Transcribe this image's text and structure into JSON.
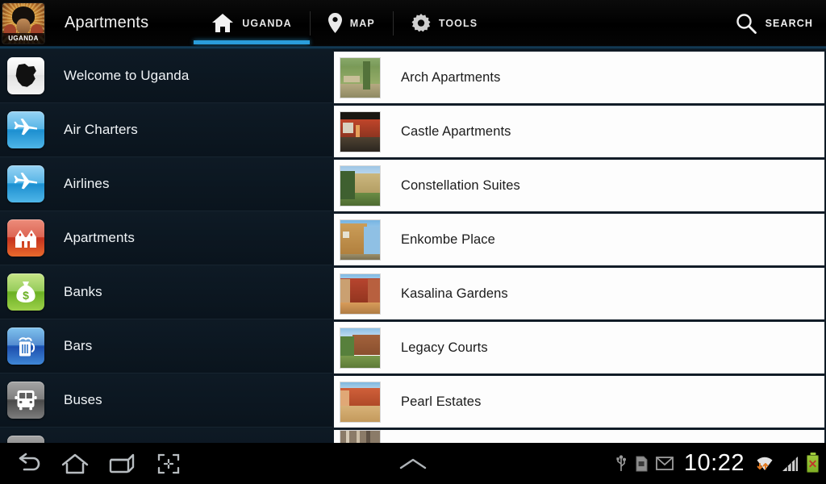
{
  "header": {
    "app_icon_label": "UGANDA",
    "title": "Apartments",
    "tabs": [
      {
        "label": "UGANDA",
        "icon": "home-icon",
        "active": true
      },
      {
        "label": "MAP",
        "icon": "location-pin-icon",
        "active": false
      },
      {
        "label": "TOOLS",
        "icon": "gear-icon",
        "active": false
      }
    ],
    "search": {
      "label": "SEARCH",
      "icon": "search-icon"
    },
    "accent_color": "#2a9ddb"
  },
  "sidebar": {
    "items": [
      {
        "label": "Welcome to Uganda",
        "icon": "uganda-map-icon",
        "icon_style": "ico-white"
      },
      {
        "label": "Air Charters",
        "icon": "airplane-icon",
        "icon_style": "ico-blue"
      },
      {
        "label": "Airlines",
        "icon": "airplane-icon",
        "icon_style": "ico-blue"
      },
      {
        "label": "Apartments",
        "icon": "house-icon",
        "icon_style": "ico-red"
      },
      {
        "label": "Banks",
        "icon": "money-bag-icon",
        "icon_style": "ico-green"
      },
      {
        "label": "Bars",
        "icon": "beer-mug-icon",
        "icon_style": "ico-navy"
      },
      {
        "label": "Buses",
        "icon": "bus-icon",
        "icon_style": "ico-gray"
      },
      {
        "label": "",
        "icon": "partial-icon",
        "icon_style": "ico-gray"
      }
    ]
  },
  "list": {
    "items": [
      {
        "label": "Arch Apartments",
        "thumb": "green-garden-walkway"
      },
      {
        "label": "Castle Apartments",
        "thumb": "red-lit-terrace"
      },
      {
        "label": "Constellation Suites",
        "thumb": "beige-building-trees"
      },
      {
        "label": "Enkombe Place",
        "thumb": "ochre-building-blue-sky"
      },
      {
        "label": "Kasalina Gardens",
        "thumb": "red-brick-balconies"
      },
      {
        "label": "Legacy Courts",
        "thumb": "brown-block-greenery"
      },
      {
        "label": "Pearl Estates",
        "thumb": "orange-waterfront"
      },
      {
        "label": "",
        "thumb": "partial-thumb"
      }
    ]
  },
  "navbar": {
    "buttons": [
      {
        "name": "back-button",
        "icon": "back-arrow-icon"
      },
      {
        "name": "home-button",
        "icon": "home-outline-icon"
      },
      {
        "name": "recents-button",
        "icon": "recents-icon"
      },
      {
        "name": "screenshot-button",
        "icon": "screenshot-icon"
      }
    ],
    "expand_icon": "chevron-up-icon"
  },
  "status": {
    "time": "10:22",
    "icons": [
      "usb-icon",
      "sd-card-icon",
      "gmail-icon",
      "wifi-icon",
      "signal-icon",
      "battery-icon"
    ],
    "battery_warning": true
  }
}
